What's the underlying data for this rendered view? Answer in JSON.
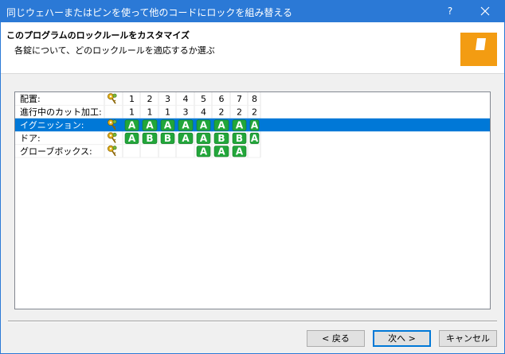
{
  "window": {
    "title": "同じウェハーまたはピンを使って他のコードにロックを組み替える",
    "help_glyph": "?",
    "close_icon": "close-icon"
  },
  "header": {
    "title": "このプログラムのロックルールをカスタマイズ",
    "subtitle": "各錠について、どのロックルールを適応するか選ぶ",
    "logo_color": "#f39c12"
  },
  "grid": {
    "selection_color": "#0078d7",
    "badge_color": "#22a63a",
    "columns": [
      "1",
      "2",
      "3",
      "4",
      "5",
      "6",
      "7",
      "8"
    ],
    "rows": [
      {
        "label": "配置:",
        "key_icon": "key-icon",
        "values": [
          "1",
          "2",
          "3",
          "4",
          "5",
          "6",
          "7",
          "8"
        ],
        "badge": false,
        "selected": false
      },
      {
        "label": "進行中のカット加工:",
        "key_icon": "",
        "values": [
          "1",
          "1",
          "1",
          "3",
          "4",
          "2",
          "2",
          "2"
        ],
        "badge": false,
        "selected": false
      },
      {
        "label": "イグニッション:",
        "key_icon": "key-icon",
        "values": [
          "A",
          "A",
          "A",
          "A",
          "A",
          "A",
          "A",
          "A"
        ],
        "badge": true,
        "selected": true
      },
      {
        "label": "ドア:",
        "key_icon": "key-icon",
        "values": [
          "A",
          "B",
          "B",
          "A",
          "A",
          "B",
          "B",
          "A"
        ],
        "badge": true,
        "selected": false
      },
      {
        "label": "グローブボックス:",
        "key_icon": "key-icon",
        "values": [
          "",
          "",
          "",
          "",
          "A",
          "A",
          "A",
          ""
        ],
        "badge": true,
        "selected": false
      }
    ]
  },
  "buttons": {
    "back": "< 戻る",
    "next": "次へ >",
    "cancel": "キャンセル"
  }
}
